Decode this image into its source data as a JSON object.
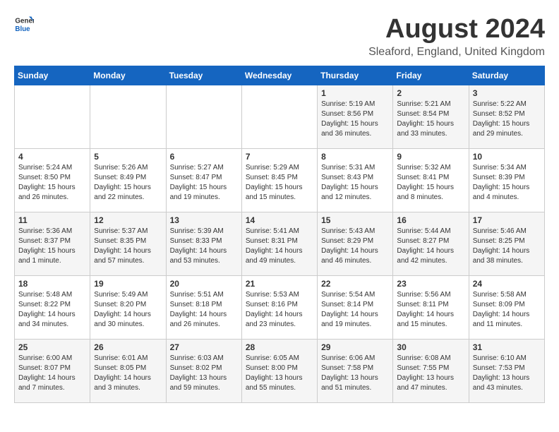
{
  "header": {
    "logo_general": "General",
    "logo_blue": "Blue",
    "title": "August 2024",
    "subtitle": "Sleaford, England, United Kingdom"
  },
  "weekdays": [
    "Sunday",
    "Monday",
    "Tuesday",
    "Wednesday",
    "Thursday",
    "Friday",
    "Saturday"
  ],
  "weeks": [
    [
      {
        "day": "",
        "sunrise": "",
        "sunset": "",
        "daylight": ""
      },
      {
        "day": "",
        "sunrise": "",
        "sunset": "",
        "daylight": ""
      },
      {
        "day": "",
        "sunrise": "",
        "sunset": "",
        "daylight": ""
      },
      {
        "day": "",
        "sunrise": "",
        "sunset": "",
        "daylight": ""
      },
      {
        "day": "1",
        "sunrise": "Sunrise: 5:19 AM",
        "sunset": "Sunset: 8:56 PM",
        "daylight": "Daylight: 15 hours and 36 minutes."
      },
      {
        "day": "2",
        "sunrise": "Sunrise: 5:21 AM",
        "sunset": "Sunset: 8:54 PM",
        "daylight": "Daylight: 15 hours and 33 minutes."
      },
      {
        "day": "3",
        "sunrise": "Sunrise: 5:22 AM",
        "sunset": "Sunset: 8:52 PM",
        "daylight": "Daylight: 15 hours and 29 minutes."
      }
    ],
    [
      {
        "day": "4",
        "sunrise": "Sunrise: 5:24 AM",
        "sunset": "Sunset: 8:50 PM",
        "daylight": "Daylight: 15 hours and 26 minutes."
      },
      {
        "day": "5",
        "sunrise": "Sunrise: 5:26 AM",
        "sunset": "Sunset: 8:49 PM",
        "daylight": "Daylight: 15 hours and 22 minutes."
      },
      {
        "day": "6",
        "sunrise": "Sunrise: 5:27 AM",
        "sunset": "Sunset: 8:47 PM",
        "daylight": "Daylight: 15 hours and 19 minutes."
      },
      {
        "day": "7",
        "sunrise": "Sunrise: 5:29 AM",
        "sunset": "Sunset: 8:45 PM",
        "daylight": "Daylight: 15 hours and 15 minutes."
      },
      {
        "day": "8",
        "sunrise": "Sunrise: 5:31 AM",
        "sunset": "Sunset: 8:43 PM",
        "daylight": "Daylight: 15 hours and 12 minutes."
      },
      {
        "day": "9",
        "sunrise": "Sunrise: 5:32 AM",
        "sunset": "Sunset: 8:41 PM",
        "daylight": "Daylight: 15 hours and 8 minutes."
      },
      {
        "day": "10",
        "sunrise": "Sunrise: 5:34 AM",
        "sunset": "Sunset: 8:39 PM",
        "daylight": "Daylight: 15 hours and 4 minutes."
      }
    ],
    [
      {
        "day": "11",
        "sunrise": "Sunrise: 5:36 AM",
        "sunset": "Sunset: 8:37 PM",
        "daylight": "Daylight: 15 hours and 1 minute."
      },
      {
        "day": "12",
        "sunrise": "Sunrise: 5:37 AM",
        "sunset": "Sunset: 8:35 PM",
        "daylight": "Daylight: 14 hours and 57 minutes."
      },
      {
        "day": "13",
        "sunrise": "Sunrise: 5:39 AM",
        "sunset": "Sunset: 8:33 PM",
        "daylight": "Daylight: 14 hours and 53 minutes."
      },
      {
        "day": "14",
        "sunrise": "Sunrise: 5:41 AM",
        "sunset": "Sunset: 8:31 PM",
        "daylight": "Daylight: 14 hours and 49 minutes."
      },
      {
        "day": "15",
        "sunrise": "Sunrise: 5:43 AM",
        "sunset": "Sunset: 8:29 PM",
        "daylight": "Daylight: 14 hours and 46 minutes."
      },
      {
        "day": "16",
        "sunrise": "Sunrise: 5:44 AM",
        "sunset": "Sunset: 8:27 PM",
        "daylight": "Daylight: 14 hours and 42 minutes."
      },
      {
        "day": "17",
        "sunrise": "Sunrise: 5:46 AM",
        "sunset": "Sunset: 8:25 PM",
        "daylight": "Daylight: 14 hours and 38 minutes."
      }
    ],
    [
      {
        "day": "18",
        "sunrise": "Sunrise: 5:48 AM",
        "sunset": "Sunset: 8:22 PM",
        "daylight": "Daylight: 14 hours and 34 minutes."
      },
      {
        "day": "19",
        "sunrise": "Sunrise: 5:49 AM",
        "sunset": "Sunset: 8:20 PM",
        "daylight": "Daylight: 14 hours and 30 minutes."
      },
      {
        "day": "20",
        "sunrise": "Sunrise: 5:51 AM",
        "sunset": "Sunset: 8:18 PM",
        "daylight": "Daylight: 14 hours and 26 minutes."
      },
      {
        "day": "21",
        "sunrise": "Sunrise: 5:53 AM",
        "sunset": "Sunset: 8:16 PM",
        "daylight": "Daylight: 14 hours and 23 minutes."
      },
      {
        "day": "22",
        "sunrise": "Sunrise: 5:54 AM",
        "sunset": "Sunset: 8:14 PM",
        "daylight": "Daylight: 14 hours and 19 minutes."
      },
      {
        "day": "23",
        "sunrise": "Sunrise: 5:56 AM",
        "sunset": "Sunset: 8:11 PM",
        "daylight": "Daylight: 14 hours and 15 minutes."
      },
      {
        "day": "24",
        "sunrise": "Sunrise: 5:58 AM",
        "sunset": "Sunset: 8:09 PM",
        "daylight": "Daylight: 14 hours and 11 minutes."
      }
    ],
    [
      {
        "day": "25",
        "sunrise": "Sunrise: 6:00 AM",
        "sunset": "Sunset: 8:07 PM",
        "daylight": "Daylight: 14 hours and 7 minutes."
      },
      {
        "day": "26",
        "sunrise": "Sunrise: 6:01 AM",
        "sunset": "Sunset: 8:05 PM",
        "daylight": "Daylight: 14 hours and 3 minutes."
      },
      {
        "day": "27",
        "sunrise": "Sunrise: 6:03 AM",
        "sunset": "Sunset: 8:02 PM",
        "daylight": "Daylight: 13 hours and 59 minutes."
      },
      {
        "day": "28",
        "sunrise": "Sunrise: 6:05 AM",
        "sunset": "Sunset: 8:00 PM",
        "daylight": "Daylight: 13 hours and 55 minutes."
      },
      {
        "day": "29",
        "sunrise": "Sunrise: 6:06 AM",
        "sunset": "Sunset: 7:58 PM",
        "daylight": "Daylight: 13 hours and 51 minutes."
      },
      {
        "day": "30",
        "sunrise": "Sunrise: 6:08 AM",
        "sunset": "Sunset: 7:55 PM",
        "daylight": "Daylight: 13 hours and 47 minutes."
      },
      {
        "day": "31",
        "sunrise": "Sunrise: 6:10 AM",
        "sunset": "Sunset: 7:53 PM",
        "daylight": "Daylight: 13 hours and 43 minutes."
      }
    ]
  ]
}
